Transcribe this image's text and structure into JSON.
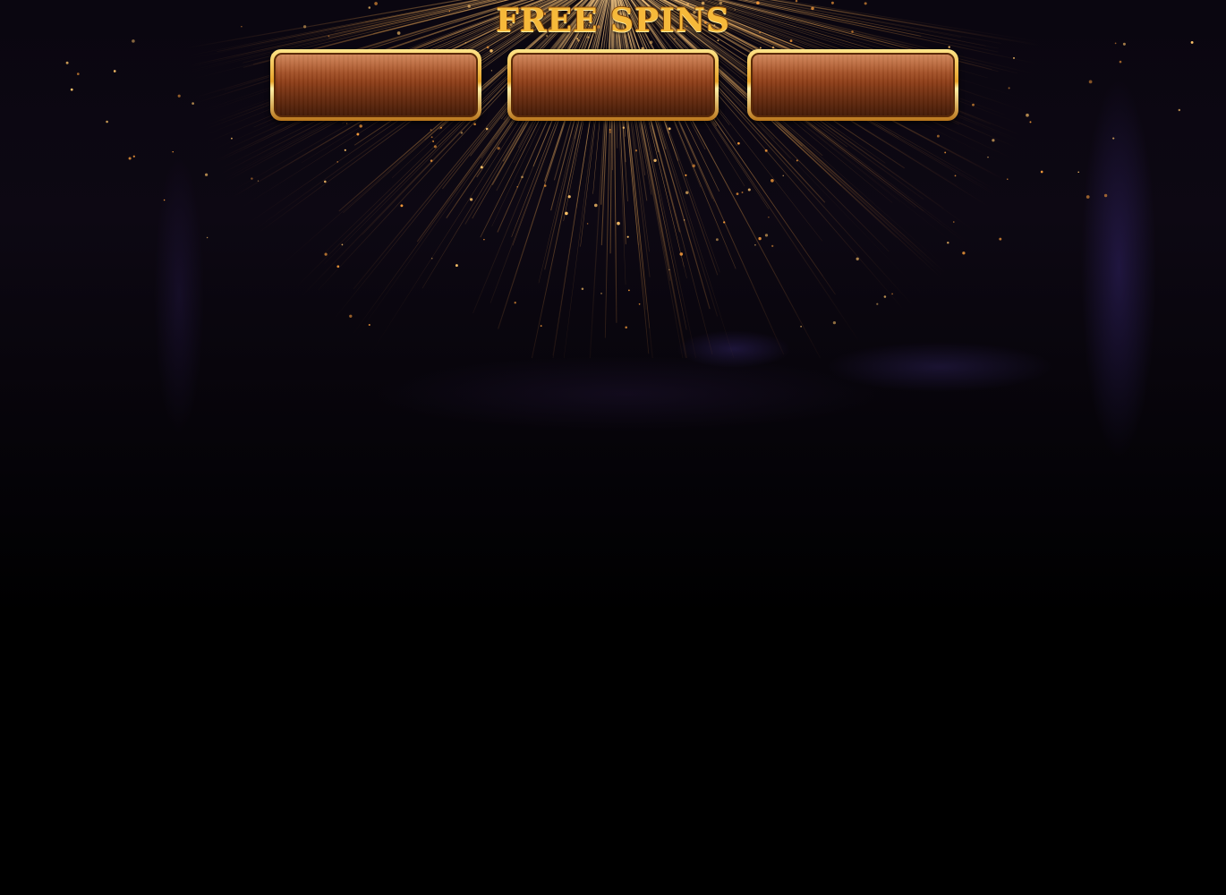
{
  "game": {
    "title": "FREE SPINS",
    "panels": [
      {
        "value": ""
      },
      {
        "value": ""
      },
      {
        "value": ""
      }
    ]
  },
  "theme": {
    "title_color": "#f6b93a",
    "frame_gold": "#e7a329",
    "panel_wood": "#8e3e18",
    "ray_color": "#e8a04a",
    "background": "#000000"
  }
}
